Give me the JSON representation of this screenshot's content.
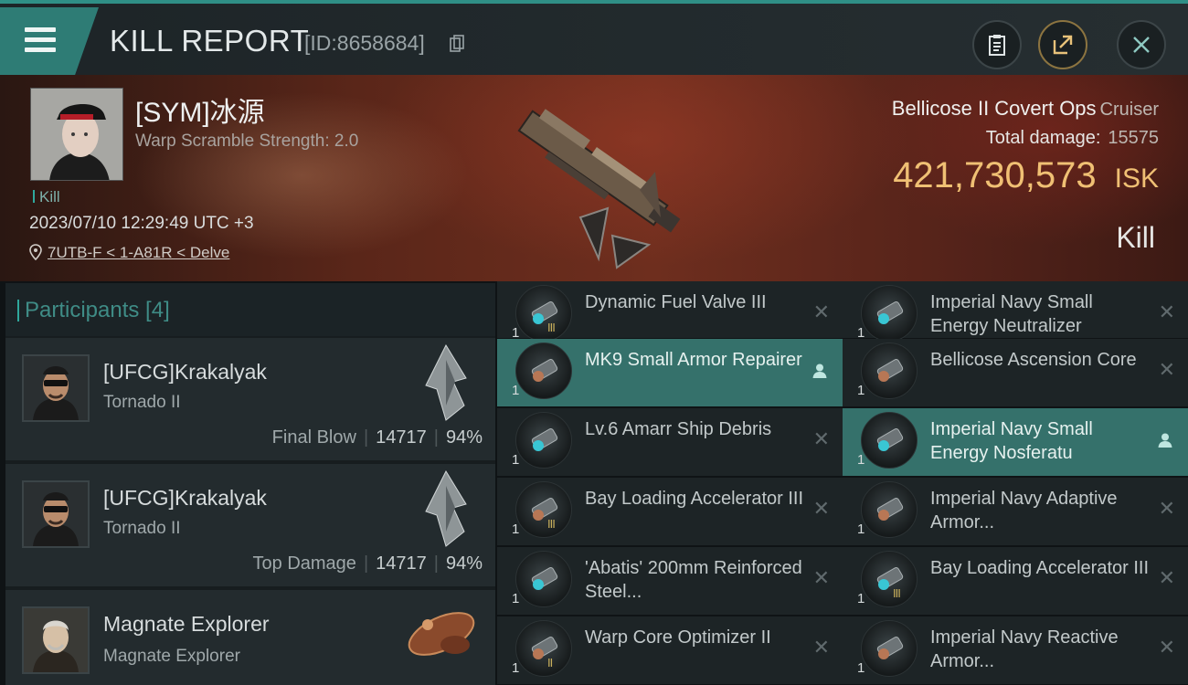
{
  "header": {
    "title": "KILL REPORT",
    "report_id": "[ID:8658684]"
  },
  "victim": {
    "name": "[SYM]冰源",
    "warp_scramble": "Warp Scramble Strength: 2.0",
    "tag": "Kill",
    "datetime": "2023/07/10 12:29:49 UTC +3",
    "location": "7UTB-F < 1-A81R < Delve",
    "ship_name": "Bellicose II Covert Ops",
    "ship_class": "Cruiser",
    "total_damage_label": "Total damage:",
    "total_damage": "15575",
    "isk_value": "421,730,573",
    "isk_unit": "ISK",
    "result": "Kill"
  },
  "participants": {
    "header": "Participants [4]",
    "rows": [
      {
        "name": "[UFCG]Krakalyak",
        "ship": "Tornado II",
        "role": "Final Blow",
        "damage": "14717",
        "percent": "94%"
      },
      {
        "name": "[UFCG]Krakalyak",
        "ship": "Tornado II",
        "role": "Top Damage",
        "damage": "14717",
        "percent": "94%"
      },
      {
        "name": "Magnate Explorer",
        "ship": "Magnate Explorer"
      }
    ]
  },
  "modules": {
    "left": [
      {
        "name": "Dynamic Fuel Valve III",
        "qty": "1",
        "meta": "III",
        "active": false
      },
      {
        "name": "MK9 Small Armor Repairer",
        "qty": "1",
        "meta": "",
        "active": true
      },
      {
        "name": "Lv.6 Amarr Ship Debris",
        "qty": "1",
        "meta": "",
        "active": false
      },
      {
        "name": "Bay Loading Accelerator III",
        "qty": "1",
        "meta": "III",
        "active": false
      },
      {
        "name": "'Abatis' 200mm Reinforced Steel...",
        "qty": "1",
        "meta": "",
        "active": false
      },
      {
        "name": "Warp Core Optimizer II",
        "qty": "1",
        "meta": "II",
        "active": false
      }
    ],
    "right": [
      {
        "name": "Imperial Navy Small Energy Neutralizer",
        "qty": "1",
        "meta": "",
        "active": false
      },
      {
        "name": "Bellicose Ascension Core",
        "qty": "1",
        "meta": "",
        "active": false
      },
      {
        "name": "Imperial Navy Small Energy Nosferatu",
        "qty": "1",
        "meta": "",
        "active": true
      },
      {
        "name": "Imperial Navy Adaptive Armor...",
        "qty": "1",
        "meta": "",
        "active": false
      },
      {
        "name": "Bay Loading Accelerator III",
        "qty": "1",
        "meta": "III",
        "active": false
      },
      {
        "name": "Imperial Navy Reactive Armor...",
        "qty": "1",
        "meta": "",
        "active": false
      }
    ]
  },
  "colors": {
    "accent": "#2e7c75",
    "isk": "#f0c074",
    "active_row": "#35716b"
  }
}
